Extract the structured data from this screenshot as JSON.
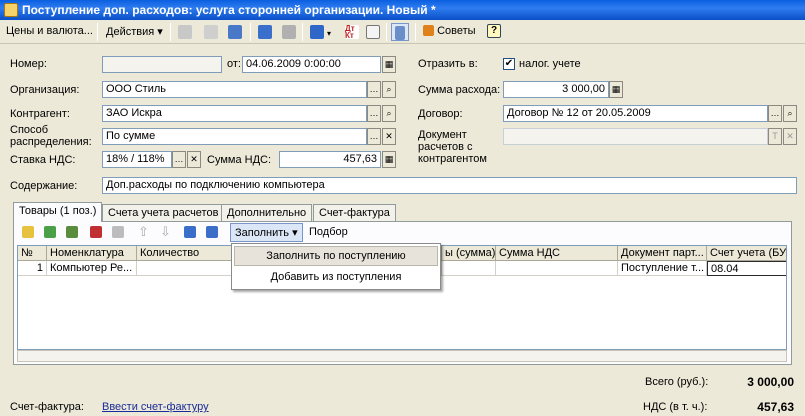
{
  "window": {
    "title": "Поступление доп. расходов: услуга сторонней организации. Новый *"
  },
  "toolbar": {
    "prices_label": "Цены и валюта...",
    "actions_label": "Действия",
    "tips_label": "Советы",
    "help_label": "?"
  },
  "form": {
    "number_label": "Номер:",
    "number_value": "",
    "from_label": "от:",
    "date_value": "04.06.2009  0:00:00",
    "reflect_label": "Отразить в:",
    "tax_label": "налог. учете",
    "tax_checked": "✔",
    "org_label": "Организация:",
    "org_value": "ООО Стиль",
    "expense_sum_label": "Сумма расхода:",
    "expense_sum_value": "3 000,00",
    "contractor_label": "Контрагент:",
    "contractor_value": "ЗАО Искра",
    "contract_label": "Договор:",
    "contract_value": "Договор № 12 от 20.05.2009",
    "method_label_1": "Способ",
    "method_label_2": "распределения:",
    "method_value": "По сумме",
    "doc_label_1": "Документ",
    "doc_label_2": "расчетов с",
    "doc_label_3": "контрагентом",
    "doc_value": "",
    "vat_rate_label": "Ставка НДС:",
    "vat_rate_value": "18% / 118%",
    "vat_sum_label": "Сумма НДС:",
    "vat_sum_value": "457,63",
    "content_label": "Содержание:",
    "content_value": "Доп.расходы  по подключению компьютера"
  },
  "tabs": [
    {
      "label": "Товары (1 поз.)"
    },
    {
      "label": "Счета учета расчетов"
    },
    {
      "label": "Дополнительно"
    },
    {
      "label": "Счет-фактура"
    }
  ],
  "grid_toolbar": {
    "fill_label": "Заполнить",
    "select_label": "Подбор"
  },
  "grid": {
    "columns": [
      "№",
      "Номенклатура",
      "Количество",
      "",
      "ы (сумма)",
      "Сумма НДС",
      "Документ парт...",
      "Счет учета (БУ)"
    ],
    "rows": [
      [
        "1",
        "Компьютер Ре...",
        "",
        "",
        "",
        "",
        "Поступление т...",
        "08.04"
      ]
    ]
  },
  "menu": {
    "items": [
      {
        "label": "Заполнить по поступлению"
      },
      {
        "label": "Добавить из поступления"
      }
    ]
  },
  "footer": {
    "total_label": "Всего (руб.):",
    "total_value": "3 000,00",
    "vat_label": "НДС (в т. ч.):",
    "vat_value": "457,63",
    "invoice_label": "Счет-фактура:",
    "invoice_link": "Ввести счет-фактуру"
  }
}
